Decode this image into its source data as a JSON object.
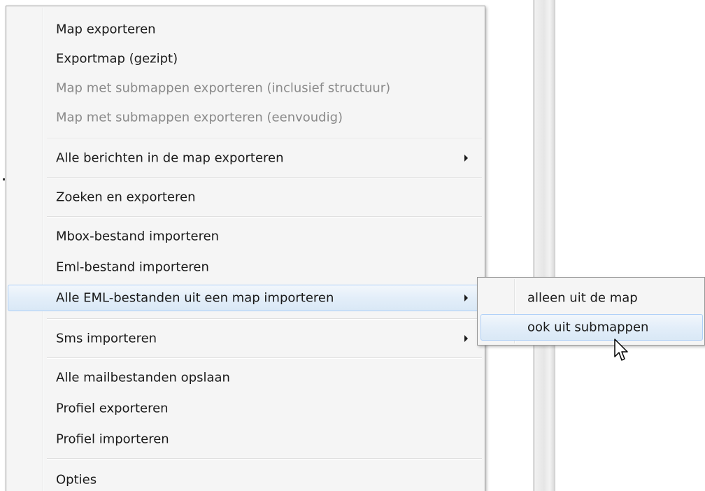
{
  "menu": {
    "items": [
      {
        "label": "Map exporteren",
        "enabled": true
      },
      {
        "label": "Exportmap (gezipt)",
        "enabled": true
      },
      {
        "label": "Map met submappen exporteren (inclusief structuur)",
        "enabled": false
      },
      {
        "label": "Map met submappen exporteren (eenvoudig)",
        "enabled": false
      },
      {
        "label": "Alle berichten in de map exporteren",
        "enabled": true,
        "has_submenu": true
      },
      {
        "label": "Zoeken en exporteren",
        "enabled": true
      },
      {
        "label": "Mbox-bestand importeren",
        "enabled": true
      },
      {
        "label": "Eml-bestand importeren",
        "enabled": true
      },
      {
        "label": "Alle EML-bestanden uit een map importeren",
        "enabled": true,
        "has_submenu": true,
        "highlighted": true
      },
      {
        "label": "Sms importeren",
        "enabled": true,
        "has_submenu": true
      },
      {
        "label": "Alle mailbestanden opslaan",
        "enabled": true
      },
      {
        "label": "Profiel exporteren",
        "enabled": true
      },
      {
        "label": "Profiel importeren",
        "enabled": true
      },
      {
        "label": "Opties",
        "enabled": true
      }
    ]
  },
  "submenu": {
    "items": [
      {
        "label": "alleen uit de map"
      },
      {
        "label": "ook uit submappen",
        "highlighted": true
      }
    ]
  },
  "colors": {
    "menu_bg": "#f5f5f5",
    "menu_border": "#979797",
    "highlight_border": "#aecff7",
    "disabled_text": "#8a8a8a",
    "text": "#1a1a1a"
  },
  "icons": {
    "submenu_arrow": "chevron-right-icon",
    "cursor": "mouse-pointer-icon"
  }
}
